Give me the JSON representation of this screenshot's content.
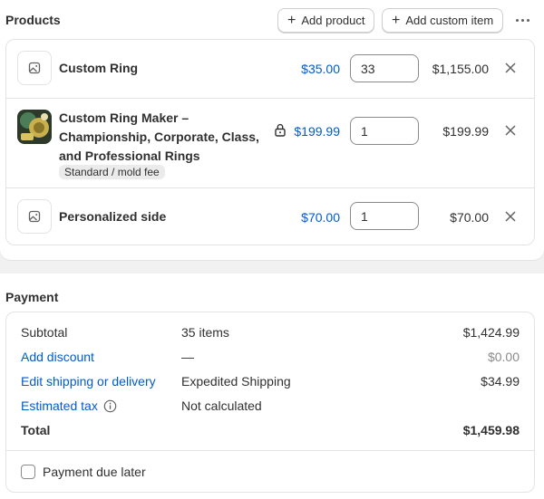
{
  "products": {
    "title": "Products",
    "add_product_label": "Add product",
    "add_custom_item_label": "Add custom item",
    "items": [
      {
        "name": "Custom Ring",
        "price": "$35.00",
        "quantity": "33",
        "total": "$1,155.00"
      },
      {
        "name_lines": [
          "Custom Ring Maker –",
          "Championship, Corporate, Class,",
          "and Professional Rings"
        ],
        "variant": "Standard / mold fee",
        "price": "$199.99",
        "quantity": "1",
        "total": "$199.99",
        "locked": true
      },
      {
        "name": "Personalized side",
        "price": "$70.00",
        "quantity": "1",
        "total": "$70.00"
      }
    ]
  },
  "payment": {
    "title": "Payment",
    "subtotal": {
      "label": "Subtotal",
      "detail": "35 items",
      "amount": "$1,424.99"
    },
    "discount": {
      "label": "Add discount",
      "detail": "—",
      "amount": "$0.00"
    },
    "shipping": {
      "label": "Edit shipping or delivery",
      "detail": "Expedited Shipping",
      "amount": "$34.99"
    },
    "tax": {
      "label": "Estimated tax",
      "detail": "Not calculated"
    },
    "total": {
      "label": "Total",
      "amount": "$1,459.98"
    },
    "due_later_label": "Payment due later"
  },
  "colors": {
    "link": "#005bd3",
    "text": "#303030",
    "border": "#e3e3e3"
  }
}
